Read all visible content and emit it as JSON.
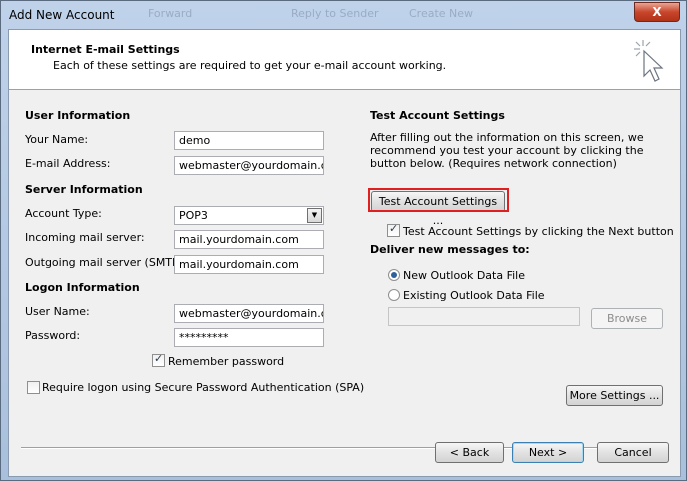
{
  "window": {
    "title": "Add New Account",
    "close_label": "X",
    "ghost_items": [
      "Forward",
      "Reply to Sender",
      "Create New"
    ]
  },
  "header": {
    "title": "Internet E-mail Settings",
    "subtitle": "Each of these settings are required to get your e-mail account working."
  },
  "user_info": {
    "heading": "User Information",
    "name_label": "Your Name:",
    "name_value": "demo",
    "email_label": "E-mail Address:",
    "email_value": "webmaster@yourdomain.com"
  },
  "server_info": {
    "heading": "Server Information",
    "account_type_label": "Account Type:",
    "account_type_value": "POP3",
    "incoming_label": "Incoming mail server:",
    "incoming_value": "mail.yourdomain.com",
    "outgoing_label": "Outgoing mail server (SMTP):",
    "outgoing_value": "mail.yourdomain.com"
  },
  "logon_info": {
    "heading": "Logon Information",
    "username_label": "User Name:",
    "username_value": "webmaster@yourdomain.com",
    "password_label": "Password:",
    "password_value": "*********",
    "remember_label": "Remember password",
    "remember_checked": true,
    "spa_label": "Require logon using Secure Password Authentication (SPA)",
    "spa_checked": false
  },
  "test_settings": {
    "heading": "Test Account Settings",
    "description": "After filling out the information on this screen, we recommend you test your account by clicking the button below. (Requires network connection)",
    "test_button": "Test Account Settings ...",
    "next_check_label": "Test Account Settings by clicking the Next button",
    "next_check_checked": true
  },
  "deliver": {
    "heading": "Deliver new messages to:",
    "new_file_label": "New Outlook Data File",
    "existing_file_label": "Existing Outlook Data File",
    "selected": "new",
    "existing_path": "",
    "browse_button": "Browse"
  },
  "more_settings_button": "More Settings ...",
  "footer": {
    "back_button": "< Back",
    "next_button": "Next >",
    "cancel_button": "Cancel"
  },
  "colors": {
    "highlight_border": "#e02020",
    "radio_dot": "#2f5f9e"
  },
  "icons": {
    "wizard": "magic-wand-cursor-icon"
  }
}
